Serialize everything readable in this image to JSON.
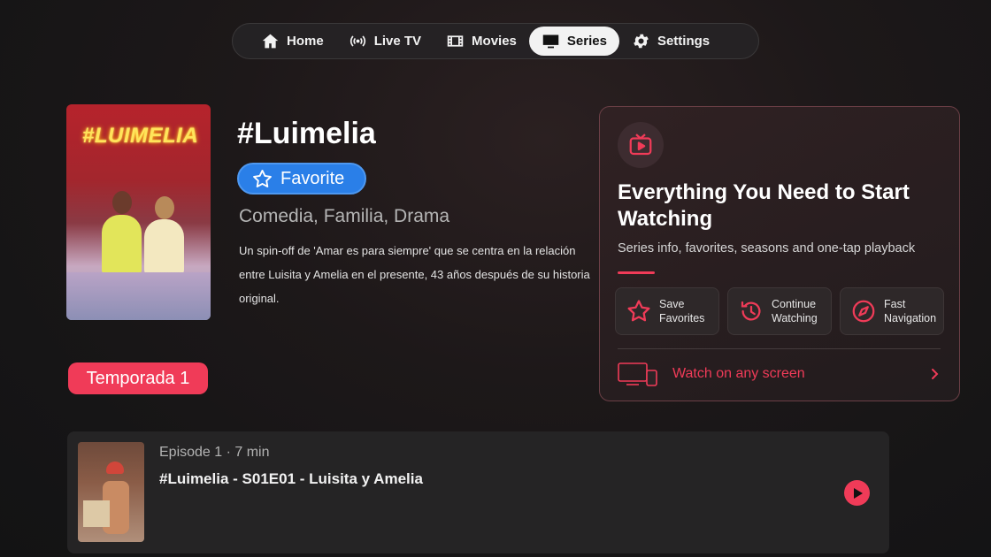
{
  "nav": {
    "items": [
      {
        "label": "Home",
        "icon": "home-icon"
      },
      {
        "label": "Live TV",
        "icon": "broadcast-icon"
      },
      {
        "label": "Movies",
        "icon": "film-icon"
      },
      {
        "label": "Series",
        "icon": "tv-icon",
        "active": true
      },
      {
        "label": "Settings",
        "icon": "gear-icon"
      }
    ]
  },
  "show": {
    "poster_text": "#LUIMELIA",
    "title": "#Luimelia",
    "favorite_label": "Favorite",
    "genres": "Comedia, Familia, Drama",
    "synopsis": "Un spin-off de 'Amar es para siempre' que se centra en la relación entre Luisita y Amelia en el presente, 43 años después de su historia original."
  },
  "season": {
    "label": "Temporada 1"
  },
  "promo": {
    "title": "Everything You Need to Start Watching",
    "subtitle": "Series info, favorites, seasons and one-tap playback",
    "features": [
      {
        "line1": "Save",
        "line2": "Favorites",
        "icon": "star-icon"
      },
      {
        "line1": "Continue",
        "line2": "Watching",
        "icon": "history-icon"
      },
      {
        "line1": "Fast",
        "line2": "Navigation",
        "icon": "compass-icon"
      }
    ],
    "screens_label": "Watch on any screen"
  },
  "episode": {
    "meta": "Episode 1 · 7 min",
    "title": "#Luimelia - S01E01 - Luisita y Amelia"
  },
  "colors": {
    "accent": "#f03b58",
    "favorite_blue": "#2a7fe8"
  }
}
